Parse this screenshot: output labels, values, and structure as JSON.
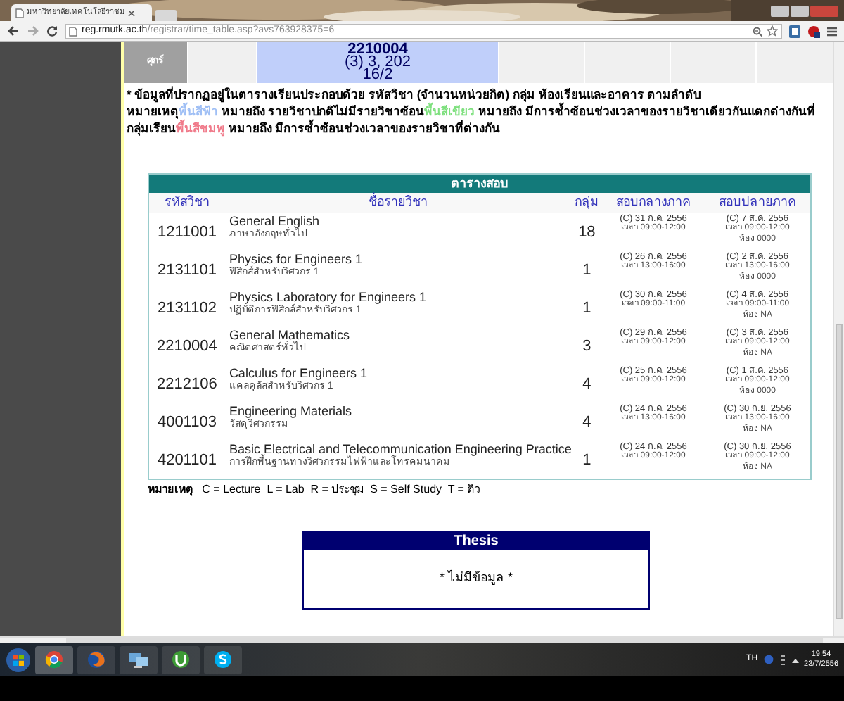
{
  "browser": {
    "tab_title": "มหาวิทยาลัยเทคโนโลยีราชม",
    "url_host": "reg.rmutk.ac.th",
    "url_path": "/registrar/time_table.asp?avs763928375=6"
  },
  "timetable": {
    "day": "ศุกร์",
    "class_lines": [
      "2210004",
      "(3) 3, 202",
      "16/2"
    ]
  },
  "notes": {
    "intro": "* ข้อมูลที่ปรากฏอยู่ในตารางเรียนประกอบด้วย รหัสวิชา (จำนวนหน่วยกิต) กลุ่ม ห้องเรียนและอาคาร ตามลำดับ",
    "lead": "หมายเหตุ",
    "legend": [
      {
        "swatch": "พื้นสีฟ้า",
        "color": "#9fbff5",
        "meaning": " หมายถึง รายวิชาปกติไม่มีรายวิชาซ้อน"
      },
      {
        "swatch": "พื้นสีเขียว",
        "color": "#7ee07e",
        "meaning": " หมายถึง มีการซ้ำซ้อนช่วงเวลาของรายวิชาเดียวกันแตกต่างกันที่กลุ่มเรียน"
      },
      {
        "swatch": "พื้นสีชมพู",
        "color": "#f07a8a",
        "meaning": " หมายถึง มีการซ้ำซ้อนช่วงเวลาของรายวิชาที่ต่างกัน"
      }
    ]
  },
  "exam_table": {
    "title": "ตารางสอบ",
    "columns": [
      "รหัสวิชา",
      "ชื่อรายวิชา",
      "กลุ่ม",
      "สอบกลางภาค",
      "สอบปลายภาค"
    ],
    "rows": [
      {
        "code": "1211001",
        "name": "General English",
        "name_th": "ภาษาอังกฤษทั่วไป",
        "group": "18",
        "midterm": [
          "(C) 31 ก.ค. 2556",
          "เวลา 09:00-12:00"
        ],
        "final": [
          "(C) 7 ส.ค. 2556",
          "เวลา 09:00-12:00",
          "ห้อง 0000"
        ]
      },
      {
        "code": "2131101",
        "name": "Physics for Engineers 1",
        "name_th": "ฟิสิกส์สำหรับวิศวกร 1",
        "group": "1",
        "midterm": [
          "(C) 26 ก.ค. 2556",
          "เวลา 13:00-16:00"
        ],
        "final": [
          "(C) 2 ส.ค. 2556",
          "เวลา 13:00-16:00",
          "ห้อง 0000"
        ]
      },
      {
        "code": "2131102",
        "name": "Physics Laboratory for Engineers 1",
        "name_th": "ปฏิบัติการฟิสิกส์สำหรับวิศวกร 1",
        "group": "1",
        "midterm": [
          "(C) 30 ก.ค. 2556",
          "เวลา 09:00-11:00"
        ],
        "final": [
          "(C) 4 ส.ค. 2556",
          "เวลา 09:00-11:00",
          "ห้อง NA"
        ]
      },
      {
        "code": "2210004",
        "name": "General Mathematics",
        "name_th": "คณิตศาสตร์ทั่วไป",
        "group": "3",
        "midterm": [
          "(C) 29 ก.ค. 2556",
          "เวลา 09:00-12:00"
        ],
        "final": [
          "(C) 3 ส.ค. 2556",
          "เวลา 09:00-12:00",
          "ห้อง NA"
        ]
      },
      {
        "code": "2212106",
        "name": "Calculus for Engineers 1",
        "name_th": "แคลคูลัสสำหรับวิศวกร 1",
        "group": "4",
        "midterm": [
          "(C) 25 ก.ค. 2556",
          "เวลา 09:00-12:00"
        ],
        "final": [
          "(C) 1 ส.ค. 2556",
          "เวลา 09:00-12:00",
          "ห้อง 0000"
        ]
      },
      {
        "code": "4001103",
        "name": "Engineering Materials",
        "name_th": "วัสดุวิศวกรรม",
        "group": "4",
        "midterm": [
          "(C) 24 ก.ค. 2556",
          "เวลา 13:00-16:00"
        ],
        "final": [
          "(C) 30 ก.ย. 2556",
          "เวลา 13:00-16:00",
          "ห้อง NA"
        ]
      },
      {
        "code": "4201101",
        "name": "Basic Electrical and Telecommunication Engineering Practice",
        "name_th": "การฝึกพื้นฐานทางวิศวกรรมไฟฟ้าและโทรคมนาคม",
        "group": "1",
        "midterm": [
          "(C) 24 ก.ค. 2556",
          "เวลา 09:00-12:00"
        ],
        "final": [
          "(C) 30 ก.ย. 2556",
          "เวลา 09:00-12:00",
          "ห้อง NA"
        ]
      }
    ]
  },
  "remark": "**หมายเหตุ**   C = Lecture  L = Lab  R = ประชุม  S = Self Study  T = ติว",
  "thesis": {
    "title": "Thesis",
    "message": "* ไม่มีข้อมูล *"
  },
  "taskbar": {
    "language": "TH",
    "time": "19:54",
    "date": "23/7/2556"
  }
}
